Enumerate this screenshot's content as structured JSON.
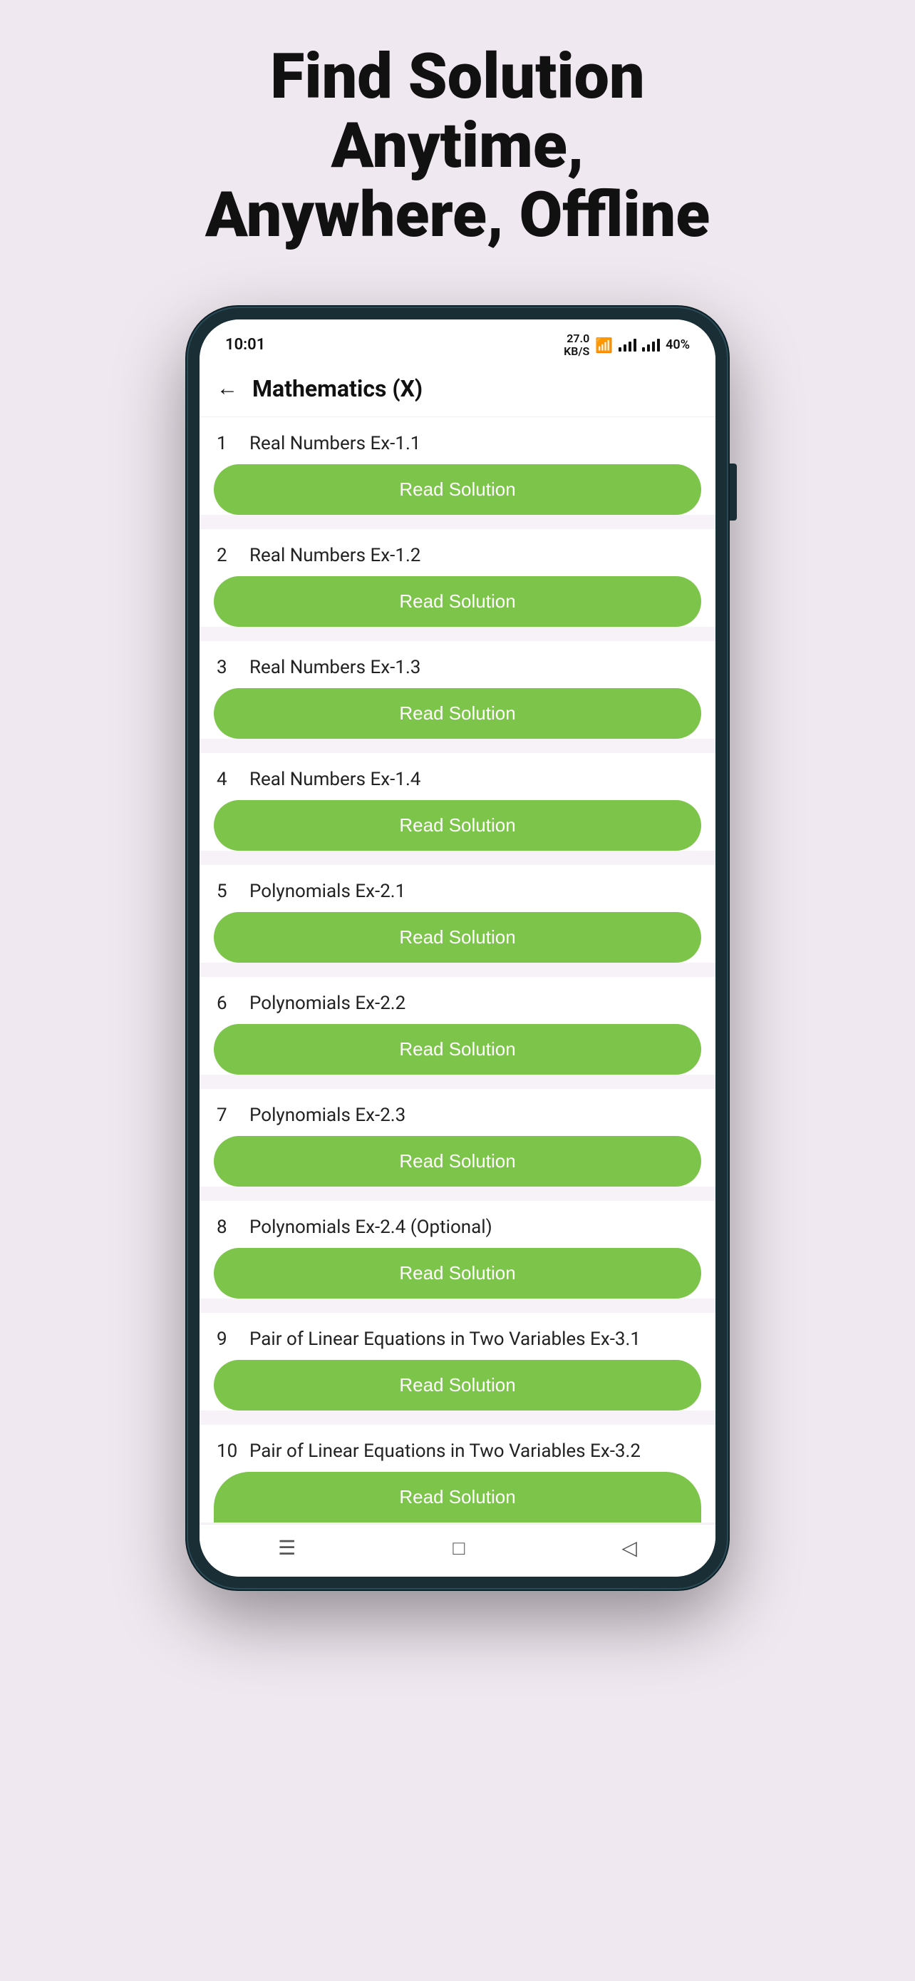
{
  "headline": {
    "line1": "Find Solution Anytime,",
    "line2": "Anywhere, Offline"
  },
  "status_bar": {
    "time": "10:01",
    "data_speed": "27.0\nKB/S",
    "battery": "40%"
  },
  "nav": {
    "title": "Mathematics (X)",
    "back_label": "←"
  },
  "read_solution_label": "Read Solution",
  "exercises": [
    {
      "number": "1",
      "name": "Real Numbers Ex-1.1"
    },
    {
      "number": "2",
      "name": "Real Numbers Ex-1.2"
    },
    {
      "number": "3",
      "name": "Real Numbers Ex-1.3"
    },
    {
      "number": "4",
      "name": "Real Numbers Ex-1.4"
    },
    {
      "number": "5",
      "name": "Polynomials Ex-2.1"
    },
    {
      "number": "6",
      "name": "Polynomials Ex-2.2"
    },
    {
      "number": "7",
      "name": "Polynomials Ex-2.3"
    },
    {
      "number": "8",
      "name": "Polynomials Ex-2.4 (Optional)"
    },
    {
      "number": "9",
      "name": "Pair of Linear Equations in Two Variables Ex-3.1"
    },
    {
      "number": "10",
      "name": "Pair of Linear Equations in Two Variables Ex-3.2"
    }
  ],
  "bottom_nav": {
    "menu_icon": "☰",
    "home_icon": "□",
    "back_icon": "◁"
  },
  "colors": {
    "green": "#7dc44a",
    "background": "#f0e8f0",
    "phone_frame": "#1a2e35"
  }
}
